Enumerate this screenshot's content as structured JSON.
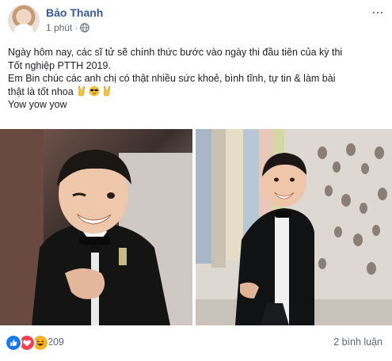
{
  "post": {
    "author": "Bảo Thanh",
    "time": "1 phút",
    "separator": "·",
    "more": "···",
    "lines": [
      "Ngày hôm nay, các sĩ tử sẽ chính thức bước vào ngày thi đầu tiên của kỳ thi",
      "Tốt nghiệp PTTH 2019.",
      "Em Bin chúc các anh chị có thật nhiều sức khoẻ, bình tĩnh, tự tin & làm bài",
      "thật là tốt nhoa",
      "Yow yow yow"
    ],
    "emojis": [
      "sign-of-horns-icon",
      "sunglasses-face-icon",
      "sign-of-horns-icon"
    ],
    "reaction_count": "209",
    "comments": "2 bình luận",
    "reactions": [
      "like-icon",
      "love-icon",
      "haha-icon"
    ]
  },
  "colors": {
    "author": "#385898",
    "meta": "#616770",
    "like": "#1877f2",
    "love": "#f33e58",
    "haha": "#f7b125"
  }
}
